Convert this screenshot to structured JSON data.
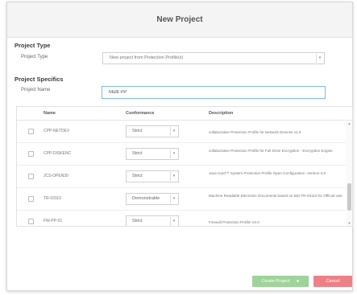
{
  "dialog": {
    "title": "New Project"
  },
  "project_type": {
    "section_title": "Project Type",
    "label": "Project Type",
    "selected": "New project from Protection Profile(s)"
  },
  "project_specifics": {
    "section_title": "Project Specifics",
    "name_label": "Project Name",
    "name_value": "Multi PP"
  },
  "table": {
    "headers": [
      "Name",
      "Conformance",
      "Description"
    ],
    "rows": [
      {
        "name": "CPP-NETDEV",
        "conformance": "Strict",
        "description": "collaborative Protection Profile for Network Devices v1.0"
      },
      {
        "name": "CPP-DISKENC",
        "conformance": "Strict",
        "description": "collaborative Protection Profile for Full Drive Encryption - Encryption Engine"
      },
      {
        "name": "JCS-OPEN30",
        "conformance": "Strict",
        "description": "Java Card™ System Protection Profile Open Configuration, Version 3.0"
      },
      {
        "name": "TR-03110",
        "conformance": "Demonstrable",
        "description": "Machine Readable Electronic Documents based on BSI TR-03110 for Official Use"
      },
      {
        "name": "FW-PP-01",
        "conformance": "Strict",
        "description": "Firewall Protection Profile V2.0"
      }
    ]
  },
  "footer": {
    "create_label": "Create Project",
    "create_icon": "plus-icon",
    "cancel_label": "Cancel"
  },
  "colors": {
    "create_button": "#9ed39a",
    "cancel_button": "#ee8088",
    "focus_border": "#7dbcd6"
  }
}
